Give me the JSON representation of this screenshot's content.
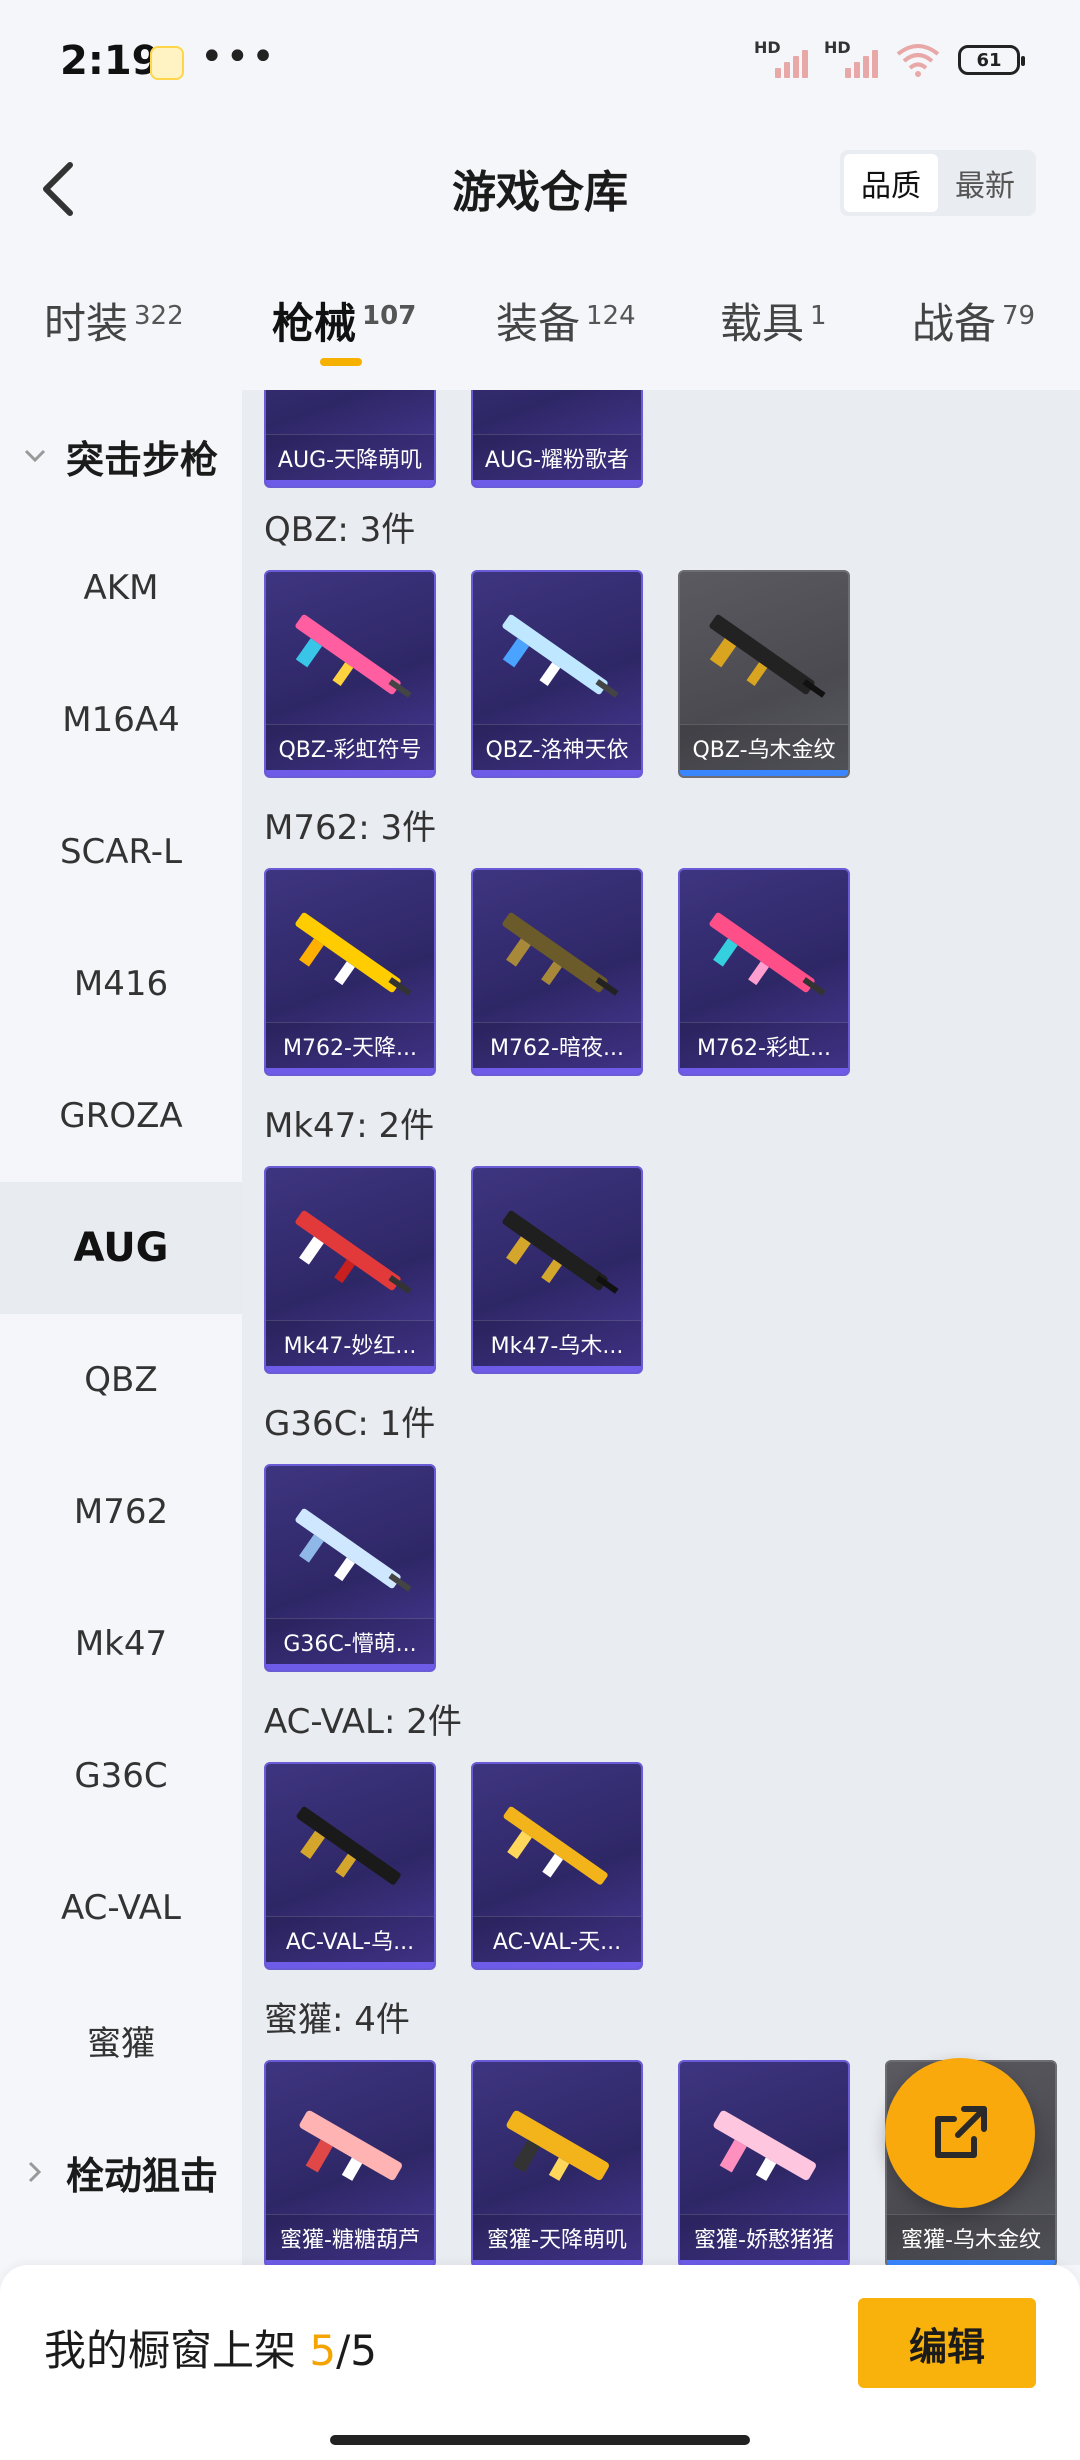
{
  "status_bar": {
    "time": "2:19",
    "dots": "•••",
    "battery": "61",
    "hd1": "HD",
    "hd2": "HD"
  },
  "header": {
    "title": "游戏仓库",
    "sort_quality": "品质",
    "sort_newest": "最新"
  },
  "tabs": [
    {
      "label": "时装",
      "count": "322"
    },
    {
      "label": "枪械",
      "count": "107"
    },
    {
      "label": "装备",
      "count": "124"
    },
    {
      "label": "载具",
      "count": "1"
    },
    {
      "label": "战备",
      "count": "79"
    }
  ],
  "sidebar": {
    "group_assault": "突击步枪",
    "items": [
      "AKM",
      "M16A4",
      "SCAR-L",
      "M416",
      "GROZA",
      "AUG",
      "QBZ",
      "M762",
      "Mk47",
      "G36C",
      "AC-VAL",
      "蜜獾"
    ],
    "group_bolt": "栓动狙击"
  },
  "content": {
    "aug_partial": [
      "AUG-天降萌叽",
      "AUG-耀粉歌者"
    ],
    "qbz": {
      "label": "QBZ: 3件",
      "items": [
        "QBZ-彩虹符号",
        "QBZ-洛神天依",
        "QBZ-乌木金纹"
      ]
    },
    "m762": {
      "label": "M762: 3件",
      "items": [
        "M762-天降...",
        "M762-暗夜...",
        "M762-彩虹..."
      ]
    },
    "mk47": {
      "label": "Mk47: 2件",
      "items": [
        "Mk47-妙红...",
        "Mk47-乌木..."
      ]
    },
    "g36c": {
      "label": "G36C: 1件",
      "items": [
        "G36C-懵萌..."
      ]
    },
    "acval": {
      "label": "AC-VAL: 2件",
      "items": [
        "AC-VAL-乌...",
        "AC-VAL-天..."
      ]
    },
    "mihuan": {
      "label": "蜜獾: 4件",
      "items": [
        "蜜獾-糖糖葫芦",
        "蜜獾-天降萌叽",
        "蜜獾-娇憨猪猪",
        "蜜獾-乌木金纹"
      ]
    }
  },
  "bottom_bar": {
    "showcase_label": "我的橱窗上架",
    "current": "5",
    "total": "/5",
    "edit": "编辑"
  },
  "colors": {
    "accent": "#f9b10c",
    "card_purple": "#3e3580",
    "card_gray": "#5a5a60"
  }
}
